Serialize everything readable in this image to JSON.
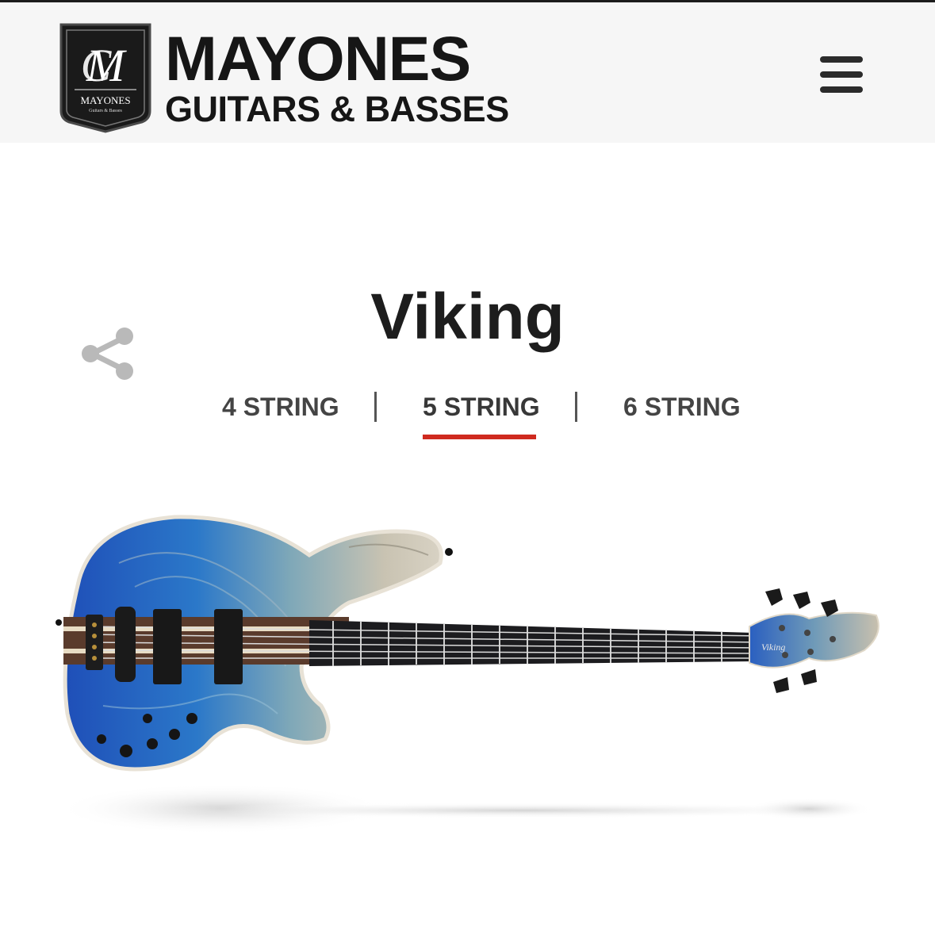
{
  "header": {
    "logo": {
      "wordmark": "MAYONES",
      "tagline": "GUITARS & BASSES",
      "badge_text": "MAYONES",
      "badge_subtext": "Guitars & Basses"
    },
    "menu_icon": "hamburger-menu-icon"
  },
  "product": {
    "title": "Viking",
    "share_icon": "share-icon",
    "image_alt": "5 string bass guitar",
    "headstock_logo": "Viking"
  },
  "tabs": [
    {
      "label": "4 STRING",
      "active": false
    },
    {
      "label": "5 STRING",
      "active": true
    },
    {
      "label": "6 STRING",
      "active": false
    }
  ],
  "colors": {
    "header_bg": "#f6f6f6",
    "accent": "#cf2a1f",
    "text_dark": "#1d1d1d",
    "icon_gray": "#b9b9b9",
    "body_blue": "#2a62c4",
    "body_natural": "#cfc7b8"
  }
}
